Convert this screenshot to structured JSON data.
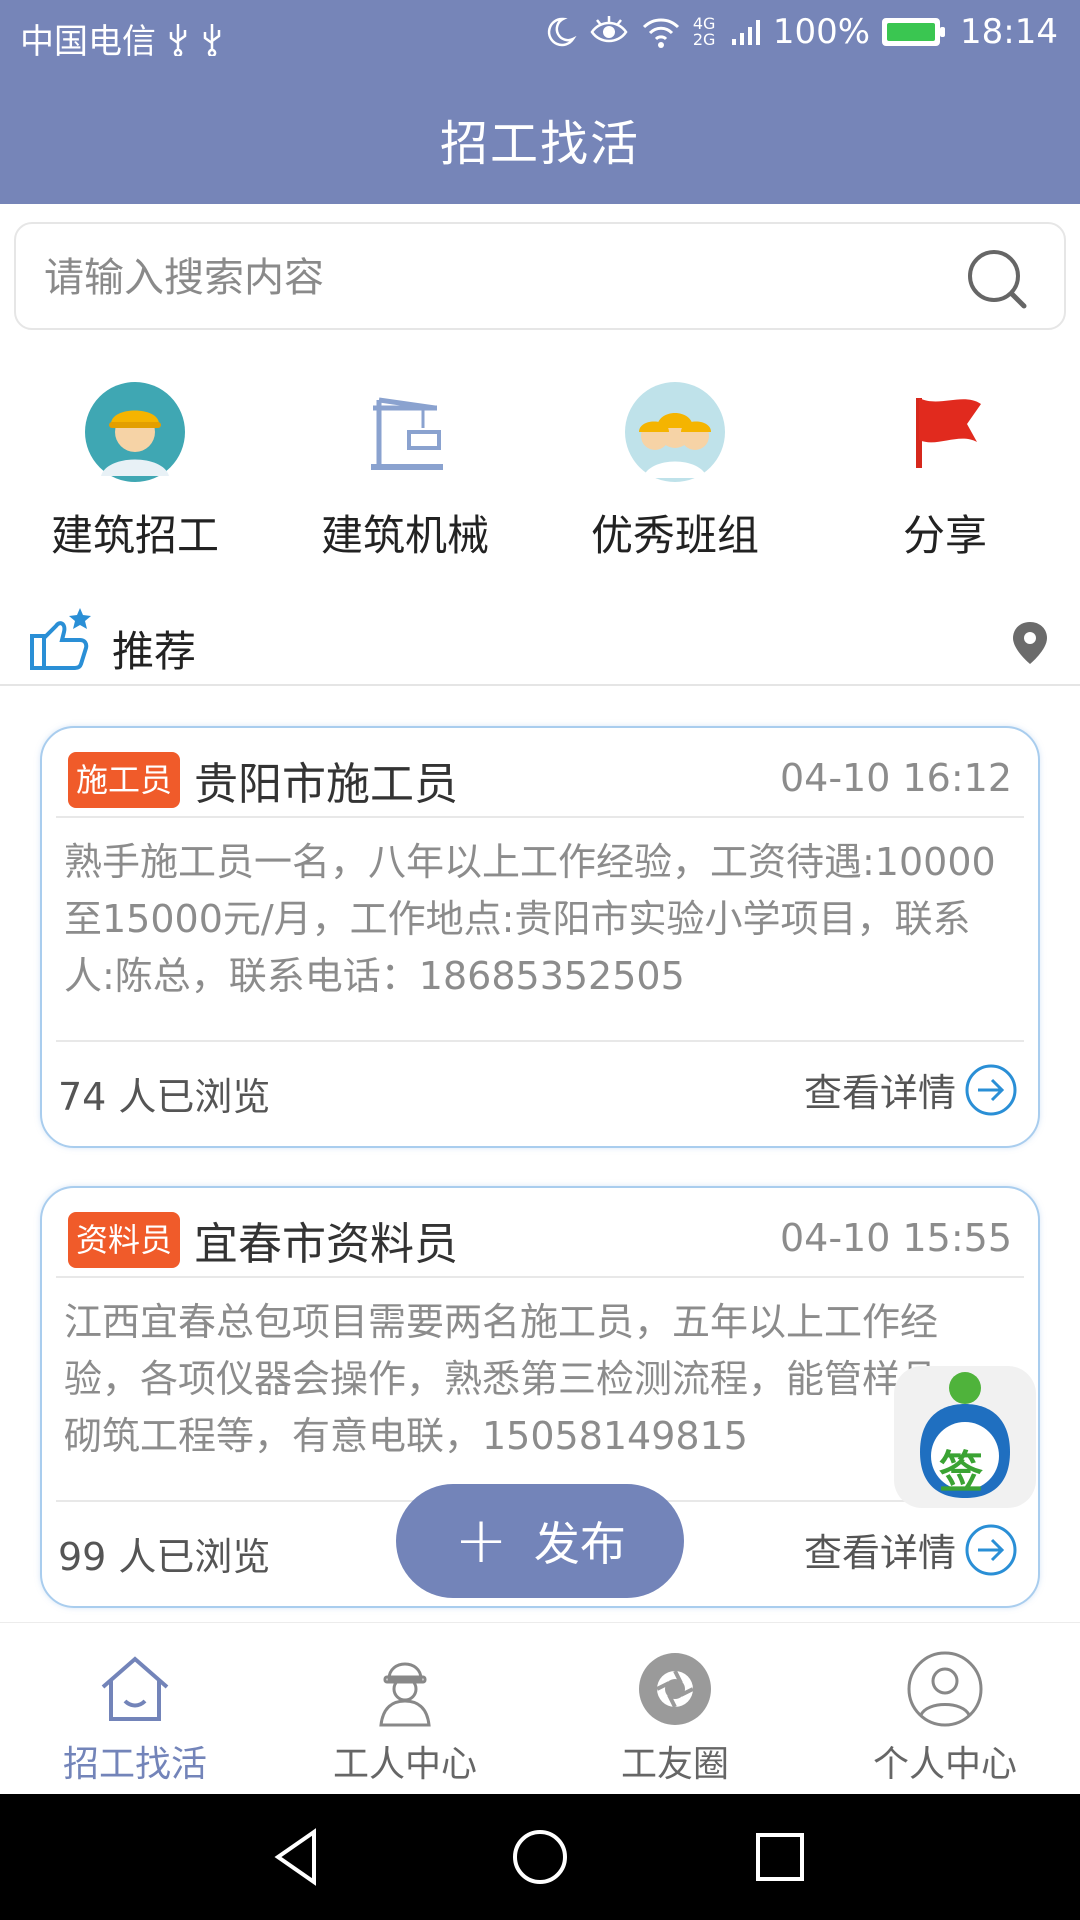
{
  "status_bar": {
    "carrier": "中国电信",
    "network": "4G 2G",
    "battery": "100%",
    "time": "18:14"
  },
  "header": {
    "title": "招工找活"
  },
  "search": {
    "placeholder": "请输入搜索内容"
  },
  "categories": [
    {
      "label": "建筑招工",
      "icon": "worker-avatar-icon"
    },
    {
      "label": "建筑机械",
      "icon": "crane-icon"
    },
    {
      "label": "优秀班组",
      "icon": "team-icon"
    },
    {
      "label": "分享",
      "icon": "red-flag-icon"
    }
  ],
  "recommend": {
    "label": "推荐"
  },
  "listings": [
    {
      "tag": "施工员",
      "title": "贵阳市施工员",
      "time": "04-10 16:12",
      "description": "熟手施工员一名，八年以上工作经验，工资待遇:10000至15000元/月，工作地点:贵阳市实验小学项目，联系人:陈总，联系电话：18685352505",
      "views": "74 人已浏览",
      "detail_label": "查看详情"
    },
    {
      "tag": "资料员",
      "title": "宜春市资料员",
      "time": "04-10 15:55",
      "description": "江西宜春总包项目需要两名施工员，五年以上工作经验，各项仪器会操作，熟悉第三检测流程，能管样品，砌筑工程等，有意电联，15058149815",
      "views": "99 人已浏览",
      "detail_label": "查看详情"
    }
  ],
  "publish_button": {
    "label": "发布"
  },
  "sign_badge": {
    "label": "签"
  },
  "tabs": [
    {
      "label": "招工找活",
      "icon": "home-icon",
      "active": true
    },
    {
      "label": "工人中心",
      "icon": "worker-icon",
      "active": false
    },
    {
      "label": "工友圈",
      "icon": "camera-aperture-icon",
      "active": false
    },
    {
      "label": "个人中心",
      "icon": "person-icon",
      "active": false
    }
  ],
  "colors": {
    "header": "#7685b8",
    "accent": "#7384b9",
    "tag": "#f05b2a",
    "card_border": "#a9cdee"
  }
}
